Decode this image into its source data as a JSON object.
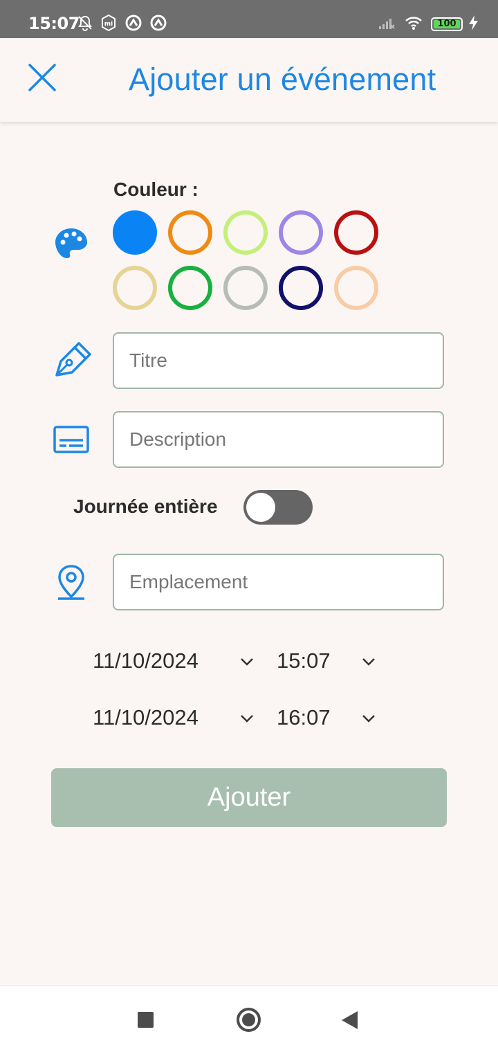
{
  "status_bar": {
    "time": "15:07",
    "battery": "100",
    "icons": [
      "notifications-off-icon",
      "mi-icon",
      "data-saver-icon",
      "data-saver-icon",
      "signal-icon",
      "wifi-icon",
      "battery-icon",
      "charging-icon"
    ]
  },
  "app_bar": {
    "title": "Ajouter un événement",
    "close_icon": "close-icon"
  },
  "color_section": {
    "label": "Couleur :",
    "icon": "palette-icon",
    "swatches": [
      {
        "color": "#0a84f5",
        "selected": true
      },
      {
        "color": "#ef8a14",
        "selected": false
      },
      {
        "color": "#c4f07a",
        "selected": false
      },
      {
        "color": "#9c86e6",
        "selected": false
      },
      {
        "color": "#b81111",
        "selected": false
      },
      {
        "color": "#e6d496",
        "selected": false
      },
      {
        "color": "#18b03f",
        "selected": false
      },
      {
        "color": "#b6bdb8",
        "selected": false
      },
      {
        "color": "#11116c",
        "selected": false
      },
      {
        "color": "#f8cda6",
        "selected": false
      }
    ]
  },
  "fields": {
    "title": {
      "placeholder": "Titre",
      "value": "",
      "icon": "pen-icon"
    },
    "description": {
      "placeholder": "Description",
      "value": "",
      "icon": "description-icon"
    },
    "location": {
      "placeholder": "Emplacement",
      "value": "",
      "icon": "location-pin-icon"
    }
  },
  "all_day": {
    "label": "Journée entière",
    "on": false
  },
  "start": {
    "date": "11/10/2024",
    "time": "15:07"
  },
  "end": {
    "date": "11/10/2024",
    "time": "16:07"
  },
  "submit": {
    "label": "Ajouter"
  },
  "colors": {
    "accent": "#1d87e4",
    "button_disabled": "#a8bfb0",
    "background": "#fbf6f3"
  }
}
